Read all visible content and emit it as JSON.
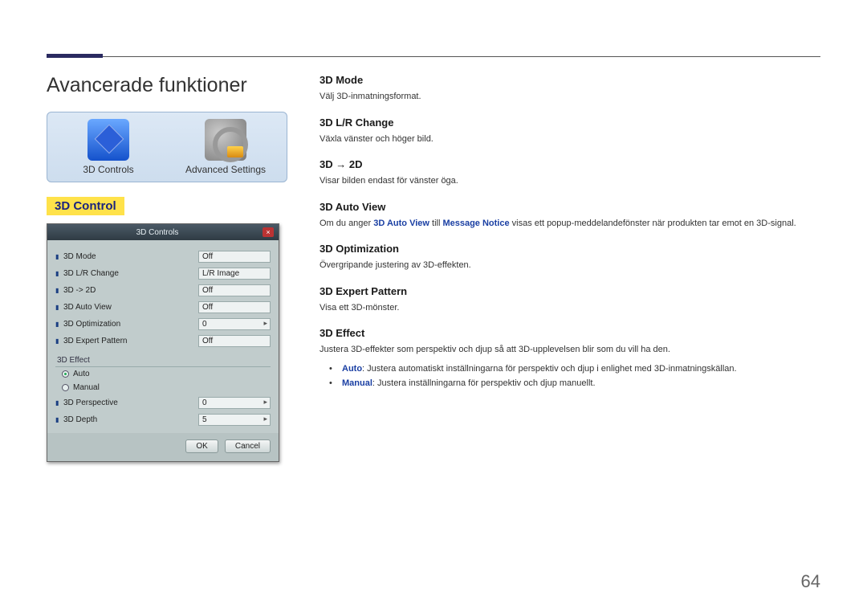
{
  "page": {
    "title": "Avancerade funktioner",
    "number": "64"
  },
  "iconset": {
    "items": [
      {
        "label": "3D Controls"
      },
      {
        "label": "Advanced Settings"
      }
    ]
  },
  "section_label": "3D Control",
  "dialog": {
    "title": "3D Controls",
    "rows": [
      {
        "label": "3D Mode",
        "value": "Off",
        "spinner": false
      },
      {
        "label": "3D L/R Change",
        "value": "L/R Image",
        "spinner": false
      },
      {
        "label": "3D -> 2D",
        "value": "Off",
        "spinner": false
      },
      {
        "label": "3D Auto View",
        "value": "Off",
        "spinner": false
      },
      {
        "label": "3D Optimization",
        "value": "0",
        "spinner": true
      },
      {
        "label": "3D Expert Pattern",
        "value": "Off",
        "spinner": false
      }
    ],
    "group_label": "3D Effect",
    "radios": [
      {
        "label": "Auto",
        "checked": true
      },
      {
        "label": "Manual",
        "checked": false
      }
    ],
    "sub_rows": [
      {
        "label": "3D Perspective",
        "value": "0",
        "spinner": true
      },
      {
        "label": "3D Depth",
        "value": "5",
        "spinner": true
      }
    ],
    "buttons": {
      "ok": "OK",
      "cancel": "Cancel"
    }
  },
  "right": {
    "sections": [
      {
        "heading": "3D Mode",
        "desc": "Välj 3D-inmatningsformat."
      },
      {
        "heading": "3D L/R Change",
        "desc": "Växla vänster och höger bild."
      },
      {
        "heading": "3D → 2D",
        "desc": "Visar bilden endast för vänster öga."
      },
      {
        "heading": "3D Auto View",
        "desc_pre": "Om du anger ",
        "kw1": "3D Auto View",
        "mid": " till ",
        "kw2": "Message Notice",
        "desc_post": " visas ett popup-meddelandefönster när produkten tar emot en 3D-signal."
      },
      {
        "heading": "3D Optimization",
        "desc": "Övergripande justering av 3D-effekten."
      },
      {
        "heading": "3D Expert Pattern",
        "desc": "Visa ett 3D-mönster."
      },
      {
        "heading": "3D Effect",
        "desc": "Justera 3D-effekter som perspektiv och djup så att 3D-upplevelsen blir som du vill ha den.",
        "bullets": [
          {
            "kw": "Auto",
            "text": ": Justera automatiskt inställningarna för perspektiv och djup i enlighet med 3D-inmatningskällan."
          },
          {
            "kw": "Manual",
            "text": ": Justera inställningarna för perspektiv och djup manuellt."
          }
        ]
      }
    ]
  }
}
